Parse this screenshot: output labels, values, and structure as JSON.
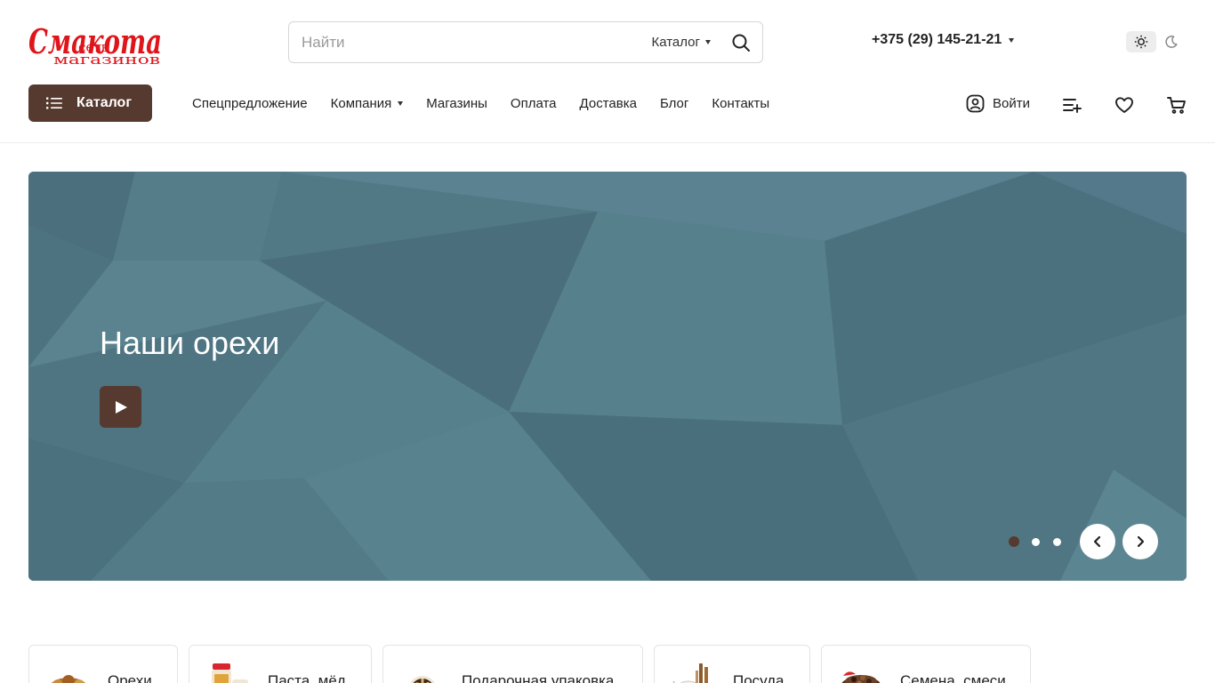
{
  "logo": {
    "text_main": "Смакота",
    "text_sub1": "сеть",
    "text_sub2": "магазинов"
  },
  "search": {
    "placeholder": "Найти",
    "category_label": "Каталог"
  },
  "phone": {
    "number": "+375 (29) 145-21-21"
  },
  "catalog_button": {
    "label": "Каталог"
  },
  "nav": {
    "items": [
      {
        "label": "Спецпредложение"
      },
      {
        "label": "Компания"
      },
      {
        "label": "Магазины"
      },
      {
        "label": "Оплата"
      },
      {
        "label": "Доставка"
      },
      {
        "label": "Блог"
      },
      {
        "label": "Контакты"
      }
    ]
  },
  "user": {
    "login_label": "Войти"
  },
  "banner": {
    "title": "Наши орехи",
    "slide_count": 3,
    "active_slide": 1
  },
  "categories": [
    {
      "label": "Орехи"
    },
    {
      "label": "Паста, мёд"
    },
    {
      "label": "Подарочная упаковка"
    },
    {
      "label": "Посуда"
    },
    {
      "label": "Семена, смеси"
    }
  ],
  "colors": {
    "accent": "#563a2f",
    "logo_red": "#e0141b",
    "banner_bg": "#517784"
  }
}
